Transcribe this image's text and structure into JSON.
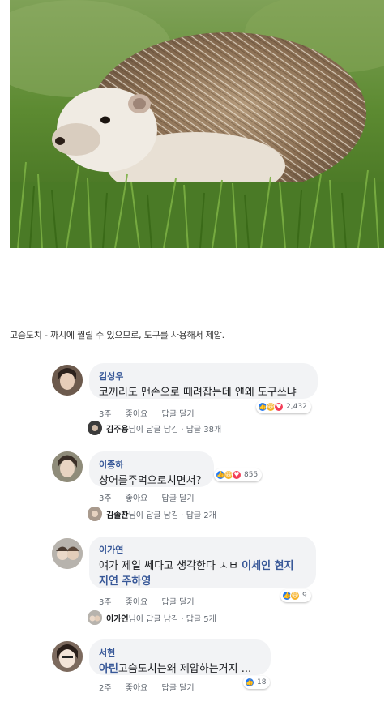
{
  "caption": "고슴도치 - 까시에 찔릴 수 있으므로, 도구를 사용해서 제압.",
  "photo": {
    "subject": "hedgehog-on-grass"
  },
  "comments": [
    {
      "name": "김성우",
      "text": "코끼리도 맨손으로 때려잡는데 얜왜 도구쓰냐",
      "time": "3주",
      "like_label": "좋아요",
      "reply_label": "답글 달기",
      "reaction_count": "2,432",
      "reply": {
        "name": "김주용",
        "suffix": "님이 답글 남김 · 답글 38개"
      }
    },
    {
      "name": "이종하",
      "text": "상어를주먹으로치면서?",
      "time": "3주",
      "like_label": "좋아요",
      "reply_label": "답글 달기",
      "reaction_count": "855",
      "reply": {
        "name": "김솔찬",
        "suffix": "님이 답글 남김 · 답글 2개"
      }
    },
    {
      "name": "이가연",
      "text_line1_plain": "얘가 제일 쎄다고 생각한다 ㅅㅂ ",
      "text_line1_tag": "이세인 현지",
      "text_line2_tag": "지연 주하영",
      "time": "3주",
      "like_label": "좋아요",
      "reply_label": "답글 달기",
      "reaction_count": "9",
      "reply": {
        "name": "이가연",
        "suffix": "님이 답글 남김 · 답글 5개"
      }
    },
    {
      "name": "서현",
      "text_tag": "아린",
      "text_plain": "고슴도치는왜 제압하는거지 ...",
      "time": "2주",
      "like_label": "좋아요",
      "reply_label": "답글 달기",
      "reaction_count": "18"
    }
  ]
}
